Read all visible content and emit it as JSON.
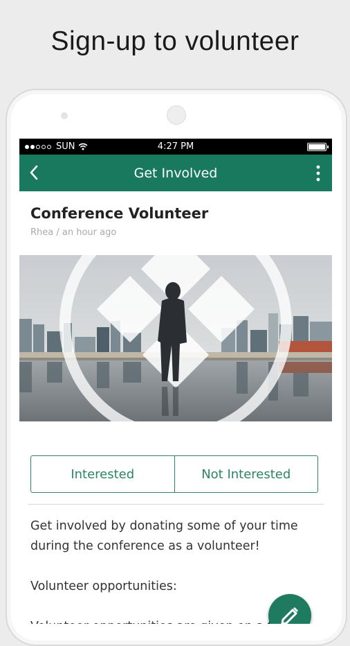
{
  "headline": "Sign-up to volunteer",
  "status_bar": {
    "carrier": "SUN",
    "time": "4:27 PM"
  },
  "app_bar": {
    "title": "Get Involved"
  },
  "post": {
    "title": "Conference Volunteer",
    "meta": "Rhea / an hour ago"
  },
  "rsvp": {
    "interested_label": "Interested",
    "not_interested_label": "Not Interested"
  },
  "body": {
    "paragraph1": "Get involved by donating some of your time during the conference as a volunteer!",
    "paragraph2": "Volunteer opportunities:",
    "paragraph3": "Volunteer opportunities are given on a first"
  },
  "colors": {
    "accent": "#18795e",
    "button_border": "#2c8468",
    "status_bar": "#000000"
  },
  "icons": {
    "back": "chevron-left-icon",
    "menu": "more-vertical-icon",
    "fab": "pencil-icon",
    "wifi": "wifi-icon",
    "battery": "battery-icon"
  }
}
